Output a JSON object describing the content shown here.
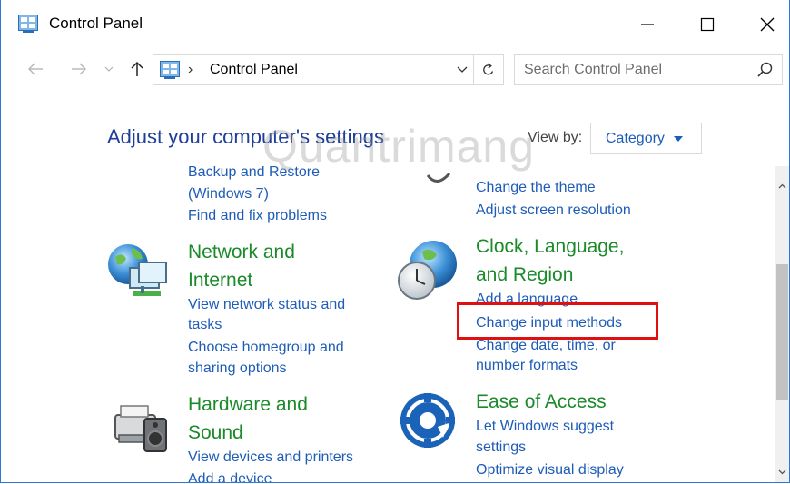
{
  "window": {
    "title": "Control Panel",
    "controls": {
      "minimize": "—",
      "maximize": "☐",
      "close": "✕"
    }
  },
  "toolbar": {
    "back": "←",
    "forward": "→",
    "recent": "⌄",
    "up": "↑",
    "address_sep": "›",
    "address_path": "Control Panel",
    "address_dropdown": "⌄",
    "refresh": "↻",
    "search_placeholder": "Search Control Panel"
  },
  "header": {
    "heading": "Adjust your computer's settings",
    "view_by_label": "View by:",
    "view_by_value": "Category"
  },
  "categories": {
    "system_security": {
      "links": [
        "Backup and Restore",
        "(Windows 7)",
        "Find and fix problems"
      ]
    },
    "appearance": {
      "links": [
        "Change the theme",
        "Adjust screen resolution"
      ]
    },
    "network": {
      "title_line1": "Network and",
      "title_line2": "Internet",
      "links": [
        "View network status and",
        "tasks",
        "Choose homegroup and",
        "sharing options"
      ]
    },
    "clock": {
      "title_line1": "Clock, Language,",
      "title_line2": "and Region",
      "links": [
        "Add a language",
        "Change input methods",
        "Change date, time, or",
        "number formats"
      ]
    },
    "hardware": {
      "title_line1": "Hardware and",
      "title_line2": "Sound",
      "links": [
        "View devices and printers",
        "Add a device"
      ]
    },
    "ease": {
      "title": "Ease of Access",
      "links": [
        "Let Windows suggest",
        "settings",
        "Optimize visual display"
      ]
    }
  },
  "watermark": "Quantrimang",
  "colors": {
    "link": "#1e5cb8",
    "category_title": "#1a8a2a",
    "heading": "#1e3e9a",
    "highlight": "#e01010"
  }
}
